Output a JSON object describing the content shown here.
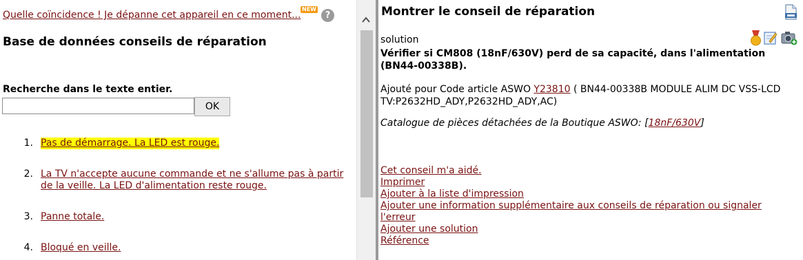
{
  "left": {
    "news_link": "Quelle coïncidence ! Je dépanne cet appareil en ce moment...",
    "new_badge": "NEW",
    "help_icon": "question-circle-icon",
    "title": "Base de données conseils de réparation",
    "search": {
      "label": "Recherche dans le texte entier.",
      "value": "",
      "placeholder": "",
      "button": "OK"
    },
    "results": [
      {
        "num": "1.",
        "text": "Pas de démarrage. La LED est rouge.",
        "highlighted": true
      },
      {
        "num": "2.",
        "text": "La TV n'accepte aucune commande et ne s'allume pas à partir de la veille. La LED d'alimentation reste rouge.",
        "highlighted": false
      },
      {
        "num": "3.",
        "text": "Panne totale.",
        "highlighted": false
      },
      {
        "num": "4.",
        "text": "Bloqué en veille.",
        "highlighted": false
      }
    ]
  },
  "right": {
    "title": "Montrer le conseil de réparation",
    "pdf_icon": "pdf-document-icon",
    "solution_label": "solution",
    "solution_icons": [
      "medal-icon",
      "edit-icon",
      "add-photo-icon"
    ],
    "solution_text": "Vérifier si CM808 (18nF/630V) perd de sa capacité, dans l'alimentation (BN44-00338B).",
    "added": {
      "prefix": "Ajouté pour Code article ASWO ",
      "article_link": "Y23810",
      "suffix": " ( BN44-00338B MODULE ALIM DC VSS-LCD TV:P2632HD_ADY,P2632HD_ADY,AC)"
    },
    "catalog": {
      "prefix": "Catalogue de pièces détachées de la Boutique ASWO: ",
      "open": "[",
      "link": "18nF/630V",
      "close": "]"
    },
    "actions": [
      "Cet conseil m'a aidé.",
      "Imprimer",
      "Ajouter à la liste d'impression",
      "Ajouter une information supplémentaire aux conseils de réparation ou signaler l'erreur",
      "Ajouter une solution",
      "Référence"
    ]
  },
  "colors": {
    "link": "#7a1212",
    "highlight": "#ffff00",
    "badge": "#f59a12"
  }
}
